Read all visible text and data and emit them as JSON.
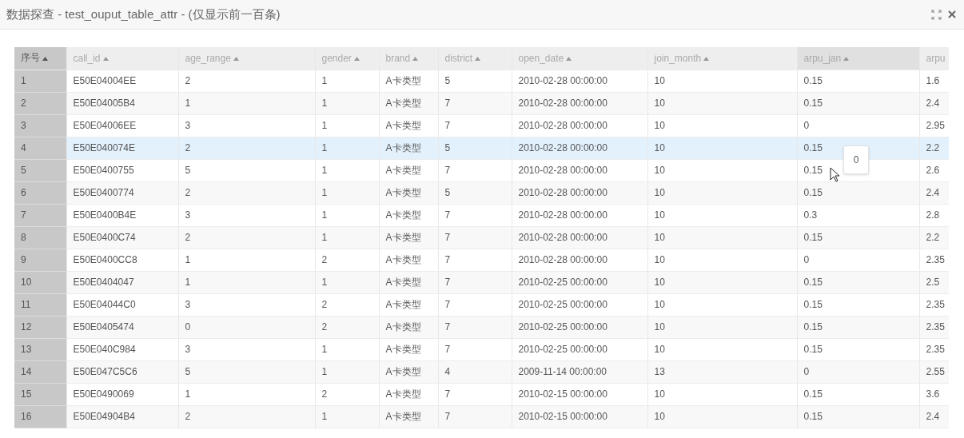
{
  "window": {
    "title": "数据探查 - test_ouput_table_attr - (仅显示前一百条)"
  },
  "table": {
    "columns": [
      {
        "label": "序号",
        "kind": "index",
        "highlighted": false
      },
      {
        "label": "call_id",
        "kind": "data",
        "highlighted": false
      },
      {
        "label": "age_range",
        "kind": "data",
        "highlighted": false
      },
      {
        "label": "gender",
        "kind": "data",
        "highlighted": false
      },
      {
        "label": "brand",
        "kind": "data",
        "highlighted": false
      },
      {
        "label": "district",
        "kind": "data",
        "highlighted": false
      },
      {
        "label": "open_date",
        "kind": "data",
        "highlighted": false
      },
      {
        "label": "join_month",
        "kind": "data",
        "highlighted": false
      },
      {
        "label": "arpu_jan",
        "kind": "data",
        "highlighted": true
      },
      {
        "label": "arpu",
        "kind": "cut",
        "highlighted": false
      }
    ],
    "rows": [
      {
        "selected": false,
        "cells": [
          "1",
          "E50E04004EE",
          "2",
          "1",
          "A卡类型",
          "5",
          "2010-02-28 00:00:00",
          "10",
          "0.15",
          "1.6"
        ]
      },
      {
        "selected": false,
        "cells": [
          "2",
          "E50E04005B4",
          "1",
          "1",
          "A卡类型",
          "7",
          "2010-02-28 00:00:00",
          "10",
          "0.15",
          "2.4"
        ]
      },
      {
        "selected": false,
        "cells": [
          "3",
          "E50E04006EE",
          "3",
          "1",
          "A卡类型",
          "7",
          "2010-02-28 00:00:00",
          "10",
          "0",
          "2.95"
        ]
      },
      {
        "selected": true,
        "cells": [
          "4",
          "E50E040074E",
          "2",
          "1",
          "A卡类型",
          "5",
          "2010-02-28 00:00:00",
          "10",
          "0.15",
          "2.2"
        ]
      },
      {
        "selected": false,
        "cells": [
          "5",
          "E50E0400755",
          "5",
          "1",
          "A卡类型",
          "7",
          "2010-02-28 00:00:00",
          "10",
          "0.15",
          "2.6"
        ]
      },
      {
        "selected": false,
        "cells": [
          "6",
          "E50E0400774",
          "2",
          "1",
          "A卡类型",
          "5",
          "2010-02-28 00:00:00",
          "10",
          "0.15",
          "2.4"
        ]
      },
      {
        "selected": false,
        "cells": [
          "7",
          "E50E0400B4E",
          "3",
          "1",
          "A卡类型",
          "7",
          "2010-02-28 00:00:00",
          "10",
          "0.3",
          "2.8"
        ]
      },
      {
        "selected": false,
        "cells": [
          "8",
          "E50E0400C74",
          "2",
          "1",
          "A卡类型",
          "7",
          "2010-02-28 00:00:00",
          "10",
          "0.15",
          "2.2"
        ]
      },
      {
        "selected": false,
        "cells": [
          "9",
          "E50E0400CC8",
          "1",
          "2",
          "A卡类型",
          "7",
          "2010-02-28 00:00:00",
          "10",
          "0",
          "2.35"
        ]
      },
      {
        "selected": false,
        "cells": [
          "10",
          "E50E0404047",
          "1",
          "1",
          "A卡类型",
          "7",
          "2010-02-25 00:00:00",
          "10",
          "0.15",
          "2.5"
        ]
      },
      {
        "selected": false,
        "cells": [
          "11",
          "E50E04044C0",
          "3",
          "2",
          "A卡类型",
          "7",
          "2010-02-25 00:00:00",
          "10",
          "0.15",
          "2.35"
        ]
      },
      {
        "selected": false,
        "cells": [
          "12",
          "E50E0405474",
          "0",
          "2",
          "A卡类型",
          "7",
          "2010-02-25 00:00:00",
          "10",
          "0.15",
          "2.35"
        ]
      },
      {
        "selected": false,
        "cells": [
          "13",
          "E50E040C984",
          "3",
          "1",
          "A卡类型",
          "7",
          "2010-02-25 00:00:00",
          "10",
          "0.15",
          "2.35"
        ]
      },
      {
        "selected": false,
        "cells": [
          "14",
          "E50E047C5C6",
          "5",
          "1",
          "A卡类型",
          "4",
          "2009-11-14 00:00:00",
          "13",
          "0",
          "2.55"
        ]
      },
      {
        "selected": false,
        "cells": [
          "15",
          "E50E0490069",
          "1",
          "2",
          "A卡类型",
          "7",
          "2010-02-15 00:00:00",
          "10",
          "0.15",
          "3.6"
        ]
      },
      {
        "selected": false,
        "cells": [
          "16",
          "E50E04904B4",
          "2",
          "1",
          "A卡类型",
          "7",
          "2010-02-15 00:00:00",
          "10",
          "0.15",
          "2.4"
        ]
      }
    ],
    "tooltip": {
      "text": "0"
    }
  }
}
